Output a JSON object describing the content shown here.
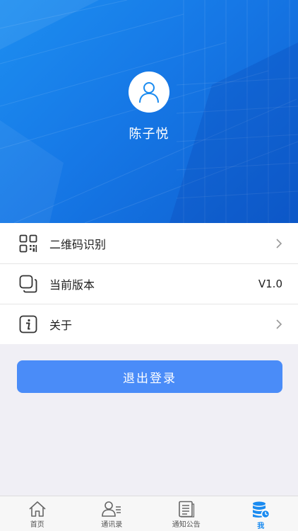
{
  "profile": {
    "name": "陈子悦"
  },
  "menu": {
    "items": [
      {
        "label": "二维码识别",
        "value": "",
        "icon": "qr-code-icon"
      },
      {
        "label": "当前版本",
        "value": "V1.0",
        "icon": "version-icon"
      },
      {
        "label": "关于",
        "value": "",
        "icon": "info-icon"
      }
    ]
  },
  "actions": {
    "logout_label": "退出登录"
  },
  "tabbar": {
    "tabs": [
      {
        "label": "首页",
        "icon": "home-icon"
      },
      {
        "label": "通讯录",
        "icon": "contacts-icon"
      },
      {
        "label": "通知公告",
        "icon": "notice-icon"
      },
      {
        "label": "我",
        "icon": "me-icon",
        "active": true
      }
    ]
  },
  "colors": {
    "accent": "#1a8bf0",
    "button": "#4a8cf8",
    "header": "#1678e6"
  }
}
